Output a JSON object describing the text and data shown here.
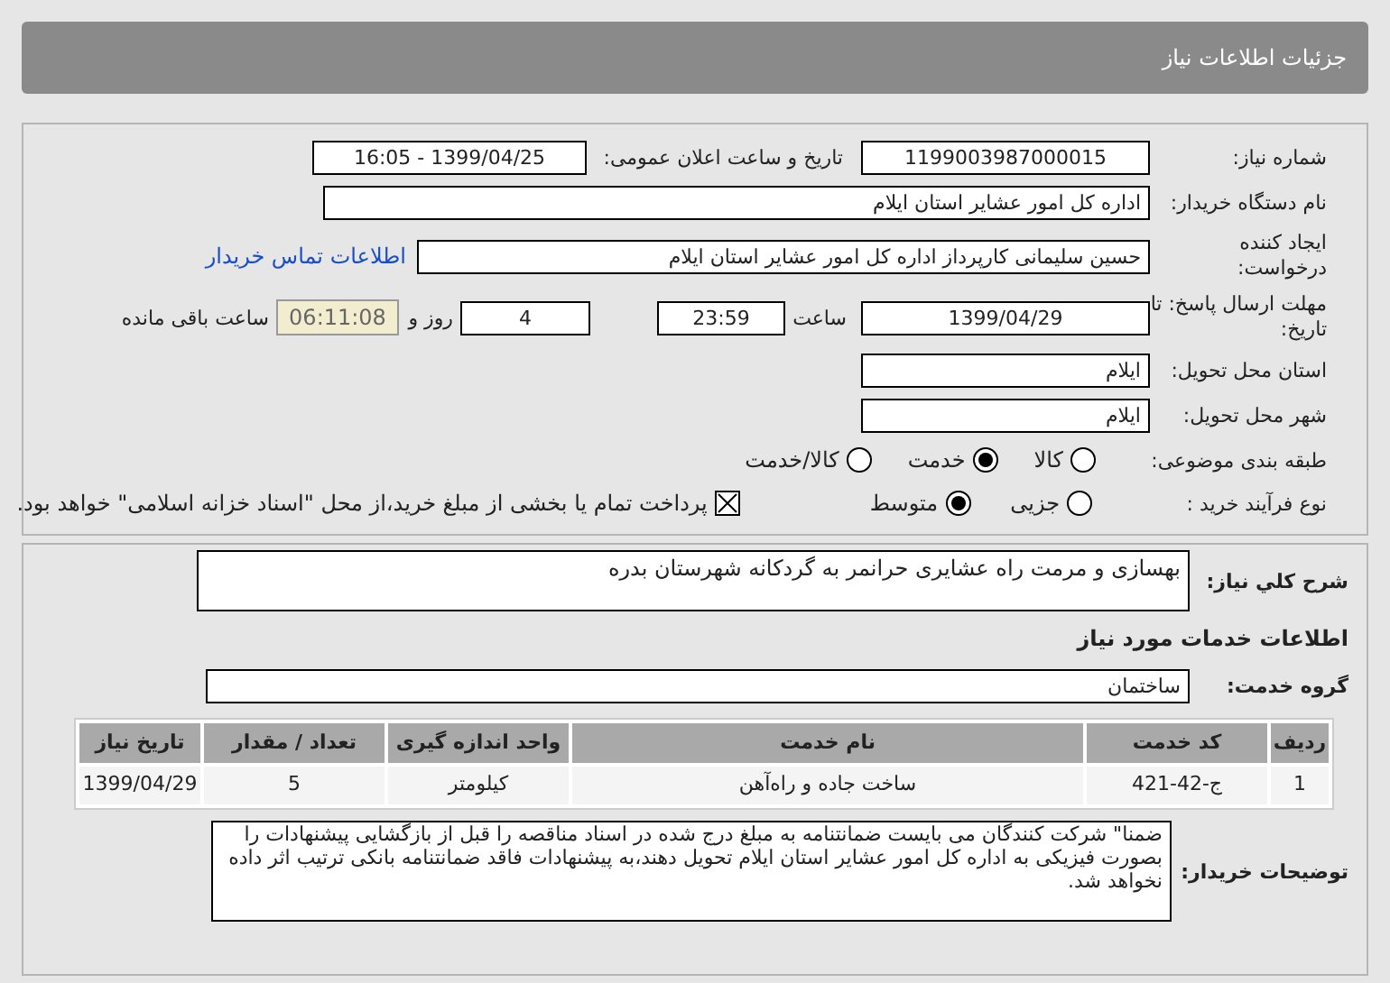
{
  "header": {
    "title": "جزئیات اطلاعات نیاز"
  },
  "fields": {
    "need_number": {
      "label": "شماره نیاز:",
      "value": "1199003987000015"
    },
    "announce": {
      "label": "تاریخ و ساعت اعلان عمومی:",
      "value": "1399/04/25 - 16:05"
    },
    "buyer": {
      "label": "نام دستگاه خریدار:",
      "value": "اداره کل امور عشایر استان ایلام"
    },
    "creator": {
      "label": "ایجاد کننده درخواست:",
      "value": "حسین سلیمانی کارپرداز اداره کل امور عشایر استان ایلام",
      "link": "اطلاعات تماس خریدار"
    },
    "deadline": {
      "label": "مهلت ارسال پاسخ: تا تاریخ:",
      "date": "1399/04/29",
      "time_label": "ساعت",
      "time": "23:59",
      "days": "4",
      "days_label": "روز و",
      "remaining": "06:11:08",
      "remaining_label": "ساعت باقی مانده"
    },
    "province": {
      "label": "استان محل تحویل:",
      "value": "ایلام"
    },
    "city": {
      "label": "شهر محل تحویل:",
      "value": "ایلام"
    }
  },
  "category": {
    "label": "طبقه بندی موضوعی:",
    "options": [
      {
        "label": "کالا",
        "selected": false
      },
      {
        "label": "خدمت",
        "selected": true
      },
      {
        "label": "کالا/خدمت",
        "selected": false
      }
    ]
  },
  "process": {
    "label": "نوع فرآیند خرید :",
    "options": [
      {
        "label": "جزیی",
        "selected": false
      },
      {
        "label": "متوسط",
        "selected": true
      }
    ],
    "payment": {
      "label": "پرداخت تمام یا بخشی از مبلغ خرید،از محل \"اسناد خزانه اسلامی\" خواهد بود.",
      "checked": true
    }
  },
  "description": {
    "label": "شرح کلي نياز:",
    "value": "بهسازی و مرمت راه عشایری حرانمر به گردکانه شهرستان بدره"
  },
  "services_heading": "اطلاعات خدمات مورد نیاز",
  "service_group": {
    "label": "گروه خدمت:",
    "value": "ساختمان"
  },
  "table": {
    "columns": [
      "ردیف",
      "کد خدمت",
      "نام خدمت",
      "واحد اندازه گیری",
      "تعداد / مقدار",
      "تاریخ نیاز"
    ],
    "rows": [
      [
        "1",
        "ج-42-421",
        "ساخت جاده و راه‌آهن",
        "کیلومتر",
        "5",
        "1399/04/29"
      ]
    ]
  },
  "buyer_notes": {
    "label": "توضیحات خریدار:",
    "value": "ضمنا\" شرکت کنندگان می بایست ضمانتنامه به مبلغ درج شده در اسناد مناقصه را قبل از بازگشایی پیشنهادات را بصورت فیزیکی به اداره کل امور عشایر استان ایلام تحویل دهند،به پیشنهادات فاقد ضمانتنامه بانکی ترتیب اثر داده نخواهد شد."
  }
}
